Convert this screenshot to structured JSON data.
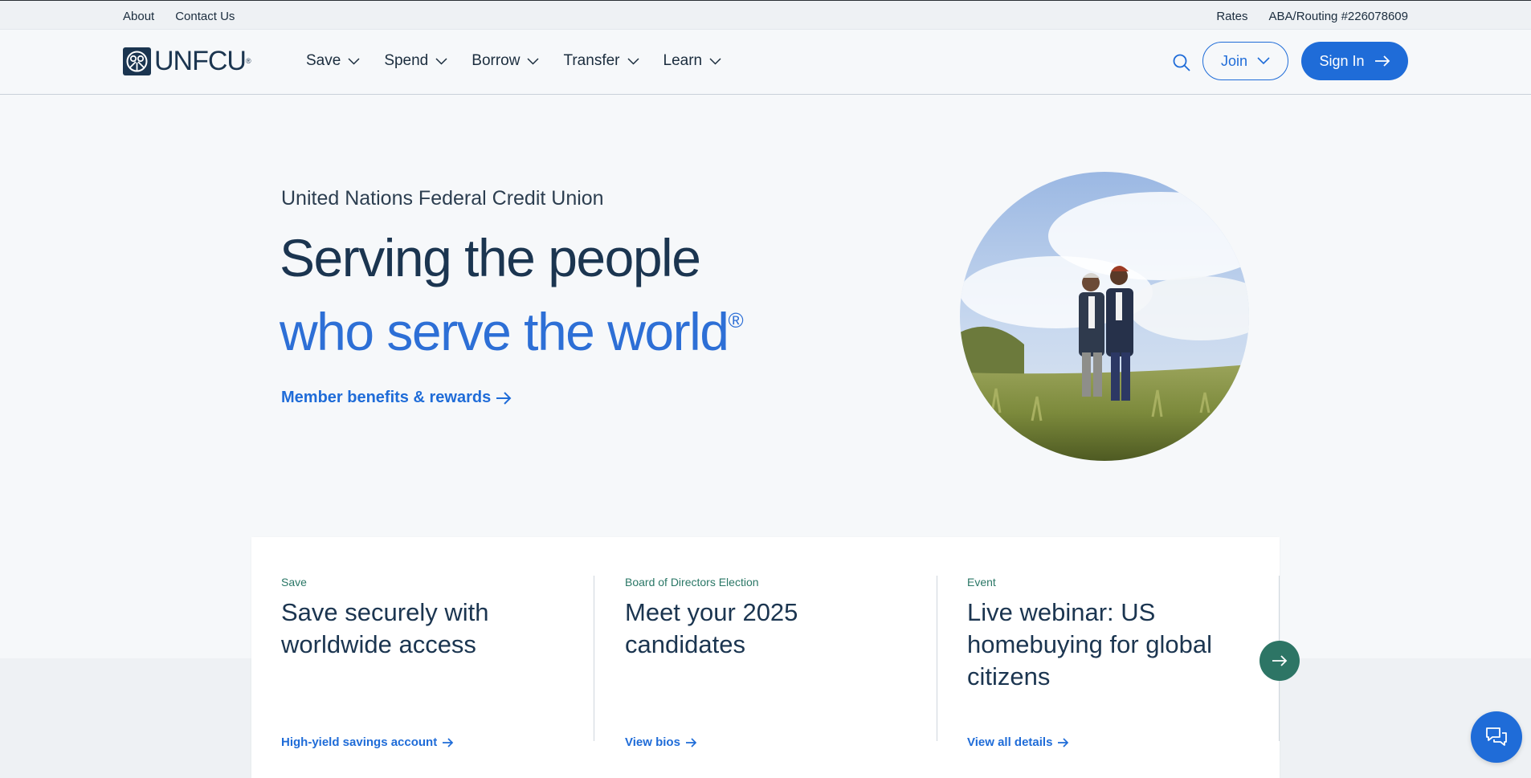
{
  "utility": {
    "left_links": [
      "About",
      "Contact Us"
    ],
    "right_links": [
      "Rates",
      "ABA/Routing #226078609"
    ]
  },
  "nav": {
    "logo_text": "UNFCU",
    "items": [
      {
        "label": "Save",
        "icon": "chevron-down-icon"
      },
      {
        "label": "Spend",
        "icon": "chevron-down-icon"
      },
      {
        "label": "Borrow",
        "icon": "chevron-down-icon"
      },
      {
        "label": "Transfer",
        "icon": "chevron-down-icon"
      },
      {
        "label": "Learn",
        "icon": "chevron-down-icon"
      }
    ],
    "search_icon": "search-icon",
    "join_label": "Join",
    "signin_label": "Sign In"
  },
  "hero": {
    "eyebrow": "United Nations Federal Credit Union",
    "title_line1": "Serving the people",
    "title_line2": "who serve the world",
    "title_mark": "®",
    "link_label": "Member benefits & rewards",
    "image": "two-women-walking-in-meadow"
  },
  "cards": [
    {
      "eyebrow": "Save",
      "title": "Save securely with worldwide access",
      "link": "High-yield savings account"
    },
    {
      "eyebrow": "Board of Directors Election",
      "title": "Meet your 2025 candidates",
      "link": "View bios"
    },
    {
      "eyebrow": "Event",
      "title": "Live webinar: US homebuying for global citizens",
      "link": "View all details"
    }
  ],
  "controls": {
    "next_icon": "arrow-right-icon",
    "chat_icon": "chat-icon"
  },
  "colors": {
    "brand_navy": "#1b3550",
    "accent_blue": "#1f6cd8",
    "teal": "#2d7565"
  }
}
